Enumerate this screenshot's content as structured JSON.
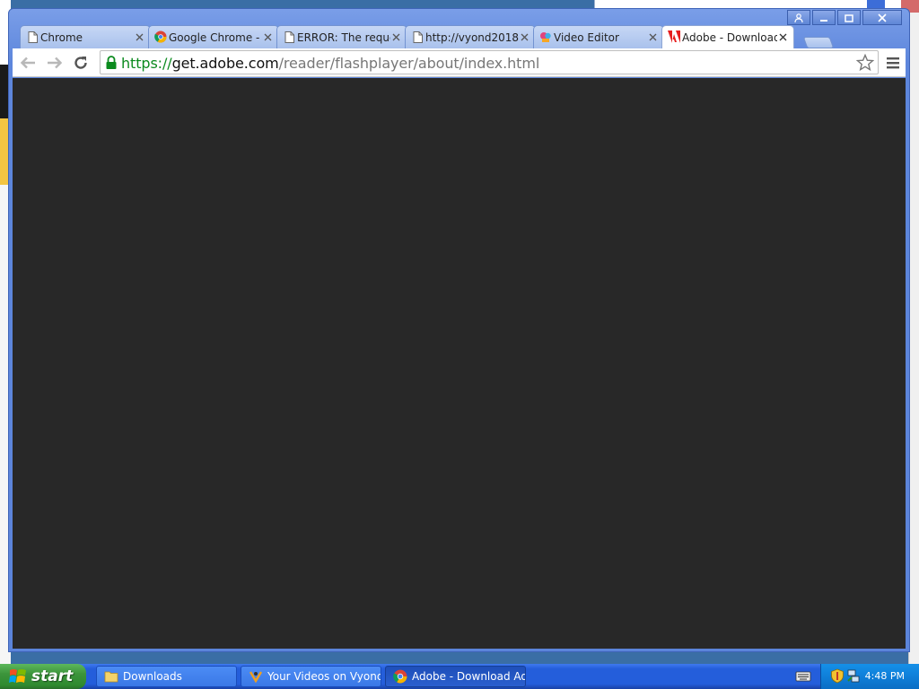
{
  "browser": {
    "tabs": [
      {
        "title": "Chrome",
        "icon": "page-icon",
        "active": false
      },
      {
        "title": "Google Chrome - Download",
        "icon": "chrome-logo-icon",
        "active": false
      },
      {
        "title": "ERROR: The requested URL",
        "icon": "page-icon",
        "active": false
      },
      {
        "title": "http://vyond2018",
        "icon": "page-icon",
        "active": false
      },
      {
        "title": "Video Editor",
        "icon": "video-editor-icon",
        "active": false
      },
      {
        "title": "Adobe - Download",
        "icon": "adobe-icon",
        "active": true
      }
    ],
    "url": {
      "scheme": "https://",
      "host": "get.adobe.com",
      "path": "/reader/flashplayer/about/index.html"
    }
  },
  "taskbar": {
    "start_label": "start",
    "tasks": [
      {
        "label": "Downloads",
        "icon": "folder-icon",
        "active": false
      },
      {
        "label": "Your Videos on Vyond...",
        "icon": "vyond-icon",
        "active": false
      },
      {
        "label": "Adobe - Download Ad...",
        "icon": "chrome-logo-icon",
        "active": true
      }
    ],
    "clock": "4:48 PM"
  },
  "colors": {
    "content_background": "#282828",
    "taskbar_blue": "#245edb",
    "start_green": "#3c943b"
  }
}
